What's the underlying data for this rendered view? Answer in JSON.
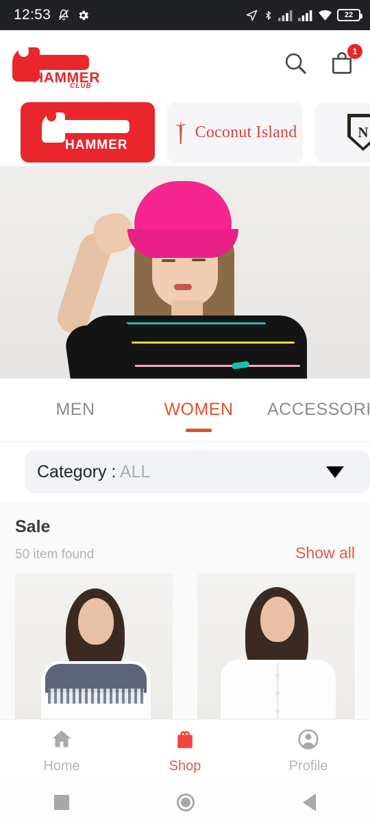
{
  "status_bar": {
    "time": "12:53",
    "battery_level": "22",
    "icons": [
      "silent-bell-icon",
      "gear-icon",
      "location-arrow-icon",
      "bluetooth-icon",
      "signal-icon",
      "signal-icon",
      "wifi-icon",
      "battery-icon"
    ]
  },
  "app_bar": {
    "logo_word": "HAMMER",
    "logo_sub": "CLUB",
    "search_icon": "search-icon",
    "bag_icon": "shopping-bag-icon",
    "cart_badge": "1"
  },
  "brands": [
    {
      "label": "HAMMER",
      "selected": true
    },
    {
      "label": "Coconut Island",
      "selected": false
    },
    {
      "label": "N",
      "selected": false
    }
  ],
  "hero": {
    "alt": "woman wearing pink bucket hat and black striped t-shirt"
  },
  "tabs": [
    {
      "label": "MEN",
      "active": false
    },
    {
      "label": "WOMEN",
      "active": true
    },
    {
      "label": "ACCESSORI",
      "active": false
    }
  ],
  "category": {
    "label": "Category : ",
    "value": "ALL",
    "caret_icon": "chevron-down-icon"
  },
  "sale": {
    "title": "Sale",
    "count_text": "50 item found",
    "show_all": "Show all",
    "products": [
      {
        "alt": "white blouse with navy lace yoke"
      },
      {
        "alt": "plain white button-up shirt"
      }
    ]
  },
  "bottom_nav": [
    {
      "label": "Home",
      "icon": "home-icon",
      "active": false
    },
    {
      "label": "Shop",
      "icon": "shop-bag-icon",
      "active": true
    },
    {
      "label": "Profile",
      "icon": "person-icon",
      "active": false
    }
  ],
  "system_nav": [
    {
      "name": "recents-button"
    },
    {
      "name": "home-button"
    },
    {
      "name": "back-button"
    }
  ],
  "colors": {
    "brand_red": "#e8262b",
    "accent_orange": "#e1512c",
    "link_red": "#e8564b",
    "status_bar_bg": "#202124"
  }
}
